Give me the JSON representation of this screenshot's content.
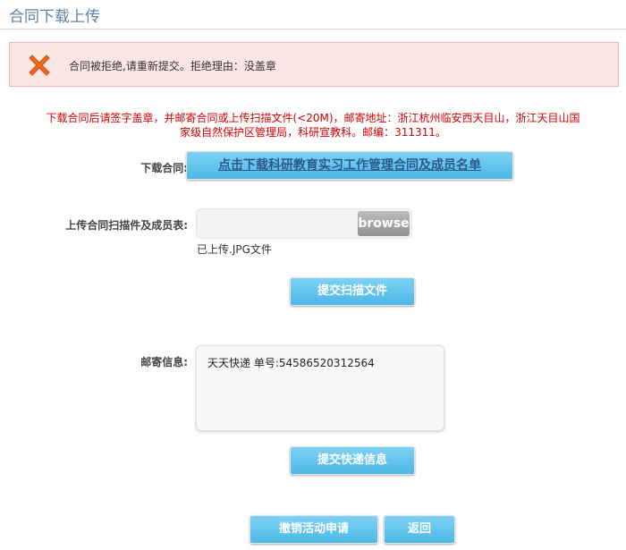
{
  "page_title": "合同下载上传",
  "alert": {
    "message": "合同被拒绝,请重新提交。拒绝理由：没盖章",
    "icon": "error-x-icon",
    "icon_color": "#f06a1a",
    "background": "#fbe5e5"
  },
  "notice": {
    "line1": "下载合同后请签字盖章，并邮寄合同或上传扫描文件(<20M)，邮寄地址：浙江杭州临安西天目山，浙江天目山国",
    "line2": "家级自然保护区管理局，科研宣教科。邮编：311311。",
    "color": "#d40000"
  },
  "download": {
    "label": "下载合同:",
    "button_label": "点击下载科研教育实习工作管理合同及成员名单"
  },
  "upload": {
    "label": "上传合同扫描件及成员表:",
    "browse_label": "browse",
    "uploaded_text": "已上传.JPG文件",
    "submit_label": "提交扫描文件"
  },
  "mail": {
    "label": "邮寄信息:",
    "value": "天天快递 单号:54586520312564",
    "submit_label": "提交快递信息"
  },
  "actions": {
    "cancel_label": "撤销活动申请",
    "back_label": "返回"
  },
  "colors": {
    "button_accent": "#4cb8e6",
    "title": "#5e7fa8"
  }
}
